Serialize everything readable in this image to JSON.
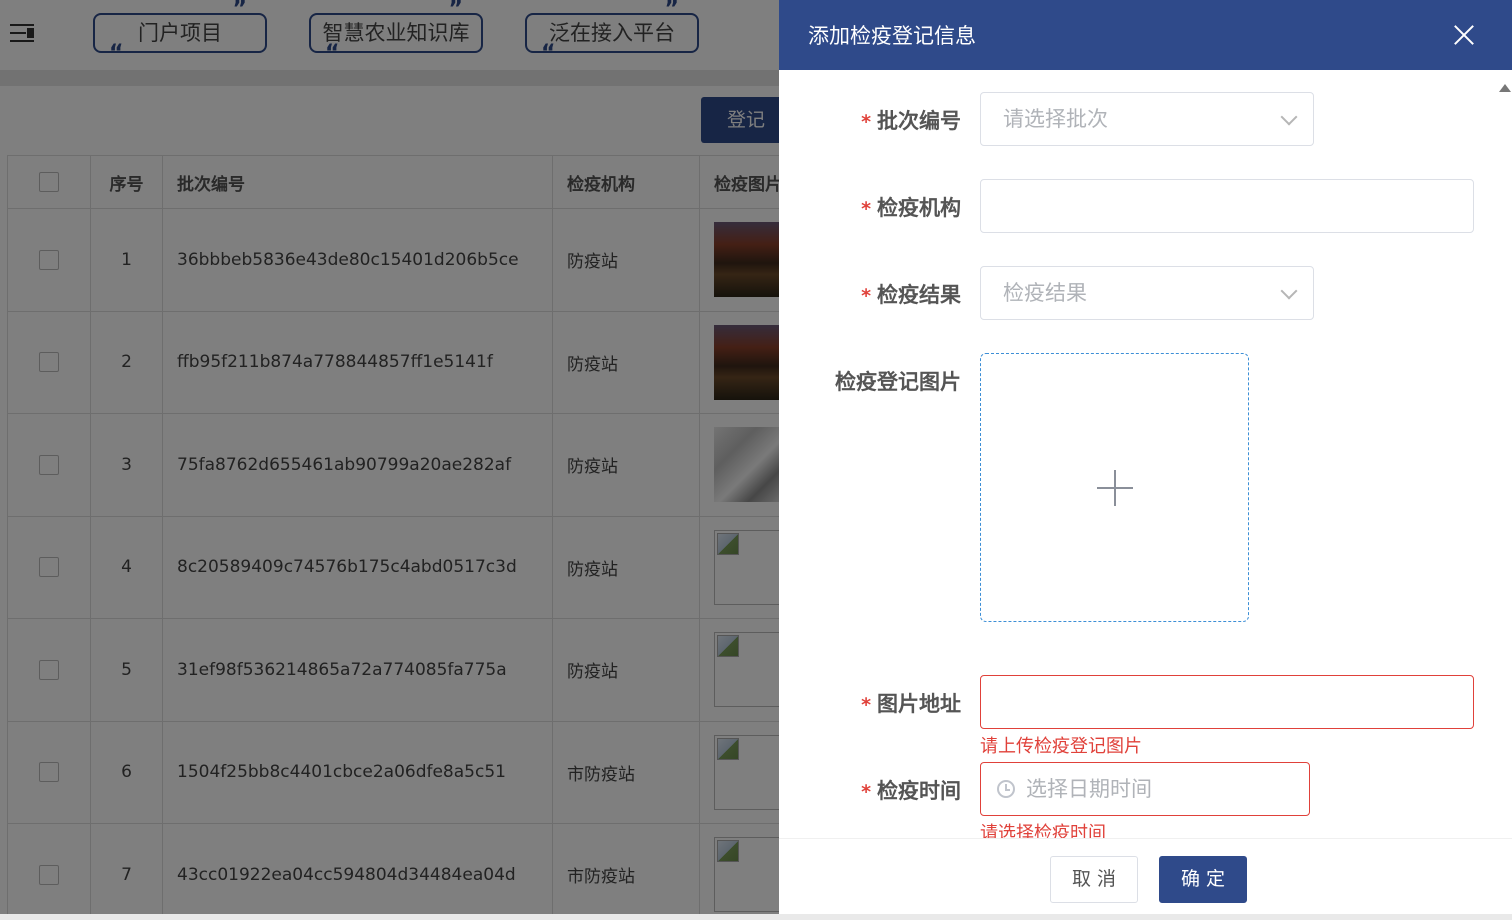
{
  "topbar": {
    "tabs": [
      {
        "label": "门户项目"
      },
      {
        "label": "智慧农业知识库"
      },
      {
        "label": "泛在接入平台"
      }
    ]
  },
  "page": {
    "register_label": "登记",
    "table": {
      "headers": {
        "index": "序号",
        "batch": "批次编号",
        "org": "检疫机构",
        "image": "检疫图片"
      },
      "rows": [
        {
          "index": "1",
          "batch": "36bbbeb5836e43de80c15401d206b5ce",
          "org": "防疫站",
          "image": "autumn"
        },
        {
          "index": "2",
          "batch": "ffb95f211b874a778844857ff1e5141f",
          "org": "防疫站",
          "image": "autumn"
        },
        {
          "index": "3",
          "batch": "75fa8762d655461ab90799a20ae282af",
          "org": "防疫站",
          "image": "snow"
        },
        {
          "index": "4",
          "batch": "8c20589409c74576b175c4abd0517c3d",
          "org": "防疫站",
          "image": "broken"
        },
        {
          "index": "5",
          "batch": "31ef98f536214865a72a774085fa775a",
          "org": "防疫站",
          "image": "broken"
        },
        {
          "index": "6",
          "batch": "1504f25bb8c4401cbce2a06dfe8a5c51",
          "org": "市防疫站",
          "image": "broken"
        },
        {
          "index": "7",
          "batch": "43cc01922ea04cc594804d34484ea04d",
          "org": "市防疫站",
          "image": "broken"
        }
      ]
    }
  },
  "drawer": {
    "title": "添加检疫登记信息",
    "required_mark": "*",
    "fields": {
      "batch": {
        "label": "批次编号",
        "placeholder": "请选择批次"
      },
      "org": {
        "label": "检疫机构",
        "value": ""
      },
      "result": {
        "label": "检疫结果",
        "placeholder": "检疫结果"
      },
      "image": {
        "label": "检疫登记图片"
      },
      "image_url": {
        "label": "图片地址",
        "value": "",
        "error": "请上传检疫登记图片"
      },
      "time": {
        "label": "检疫时间",
        "placeholder": "选择日期时间",
        "error": "请选择检疫时间"
      }
    },
    "buttons": {
      "cancel": "取 消",
      "ok": "确 定"
    }
  },
  "colors": {
    "primary": "#2f4a8a",
    "error": "#e0413a",
    "upload_border": "#3d8fd6"
  },
  "icons": [
    "menu-toggle-icon",
    "close-icon",
    "chevron-down-icon",
    "clock-icon",
    "plus-icon",
    "scroll-up-icon"
  ]
}
